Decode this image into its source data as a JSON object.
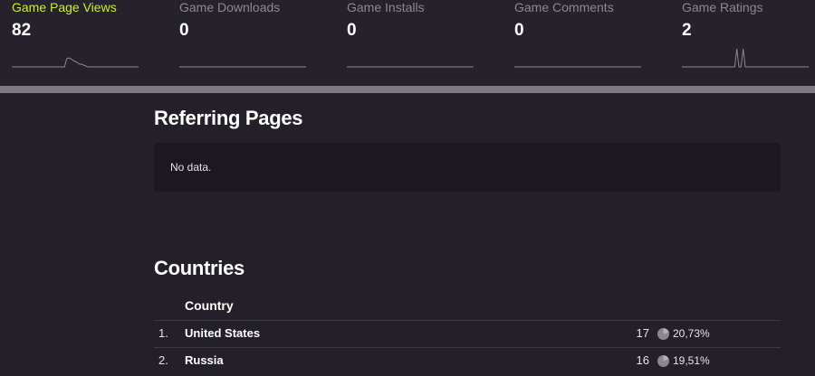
{
  "stats": [
    {
      "label": "Game Page Views",
      "value": "82",
      "active": true,
      "spark": [
        0,
        0,
        0,
        0,
        0,
        0,
        0,
        0,
        0,
        0,
        0,
        0,
        0,
        0,
        0,
        0,
        0,
        0,
        0,
        0,
        0,
        0,
        0,
        0,
        0,
        0,
        9,
        10,
        9,
        7,
        6,
        5,
        3,
        3,
        2,
        1,
        0,
        0,
        0,
        0,
        0,
        0,
        0,
        0,
        0,
        0,
        0,
        0,
        0,
        0,
        0,
        0,
        0,
        0,
        0,
        0,
        0,
        0,
        0,
        0,
        0
      ]
    },
    {
      "label": "Game Downloads",
      "value": "0",
      "active": false,
      "spark": [
        0,
        0
      ]
    },
    {
      "label": "Game Installs",
      "value": "0",
      "active": false,
      "spark": [
        0,
        0
      ]
    },
    {
      "label": "Game Comments",
      "value": "0",
      "active": false,
      "spark": [
        0,
        0
      ]
    },
    {
      "label": "Game Ratings",
      "value": "2",
      "active": false,
      "spark": [
        0,
        0,
        0,
        0,
        0,
        0,
        0,
        0,
        0,
        0,
        0,
        0,
        0,
        0,
        0,
        0,
        0,
        0,
        0,
        0,
        0,
        0,
        0,
        0,
        0,
        0,
        20,
        0,
        0,
        20,
        0,
        0,
        0,
        0,
        0,
        0,
        0,
        0,
        0,
        0,
        0,
        0,
        0,
        0,
        0,
        0,
        0,
        0,
        0,
        0,
        0,
        0,
        0,
        0,
        0,
        0,
        0,
        0,
        0,
        0,
        0
      ]
    }
  ],
  "referring": {
    "heading": "Referring Pages",
    "empty_text": "No data."
  },
  "countries": {
    "heading": "Countries",
    "column_header": "Country",
    "rows": [
      {
        "rank": "1.",
        "name": "United States",
        "count": "17",
        "percent": "20,73%",
        "fraction": 0.2073
      },
      {
        "rank": "2.",
        "name": "Russia",
        "count": "16",
        "percent": "19,51%",
        "fraction": 0.1951
      }
    ]
  },
  "colors": {
    "active_label": "#c8ee3a",
    "inactive_label": "#8b8794",
    "sparkline": "#8b8794",
    "pie": "#8a8690"
  }
}
